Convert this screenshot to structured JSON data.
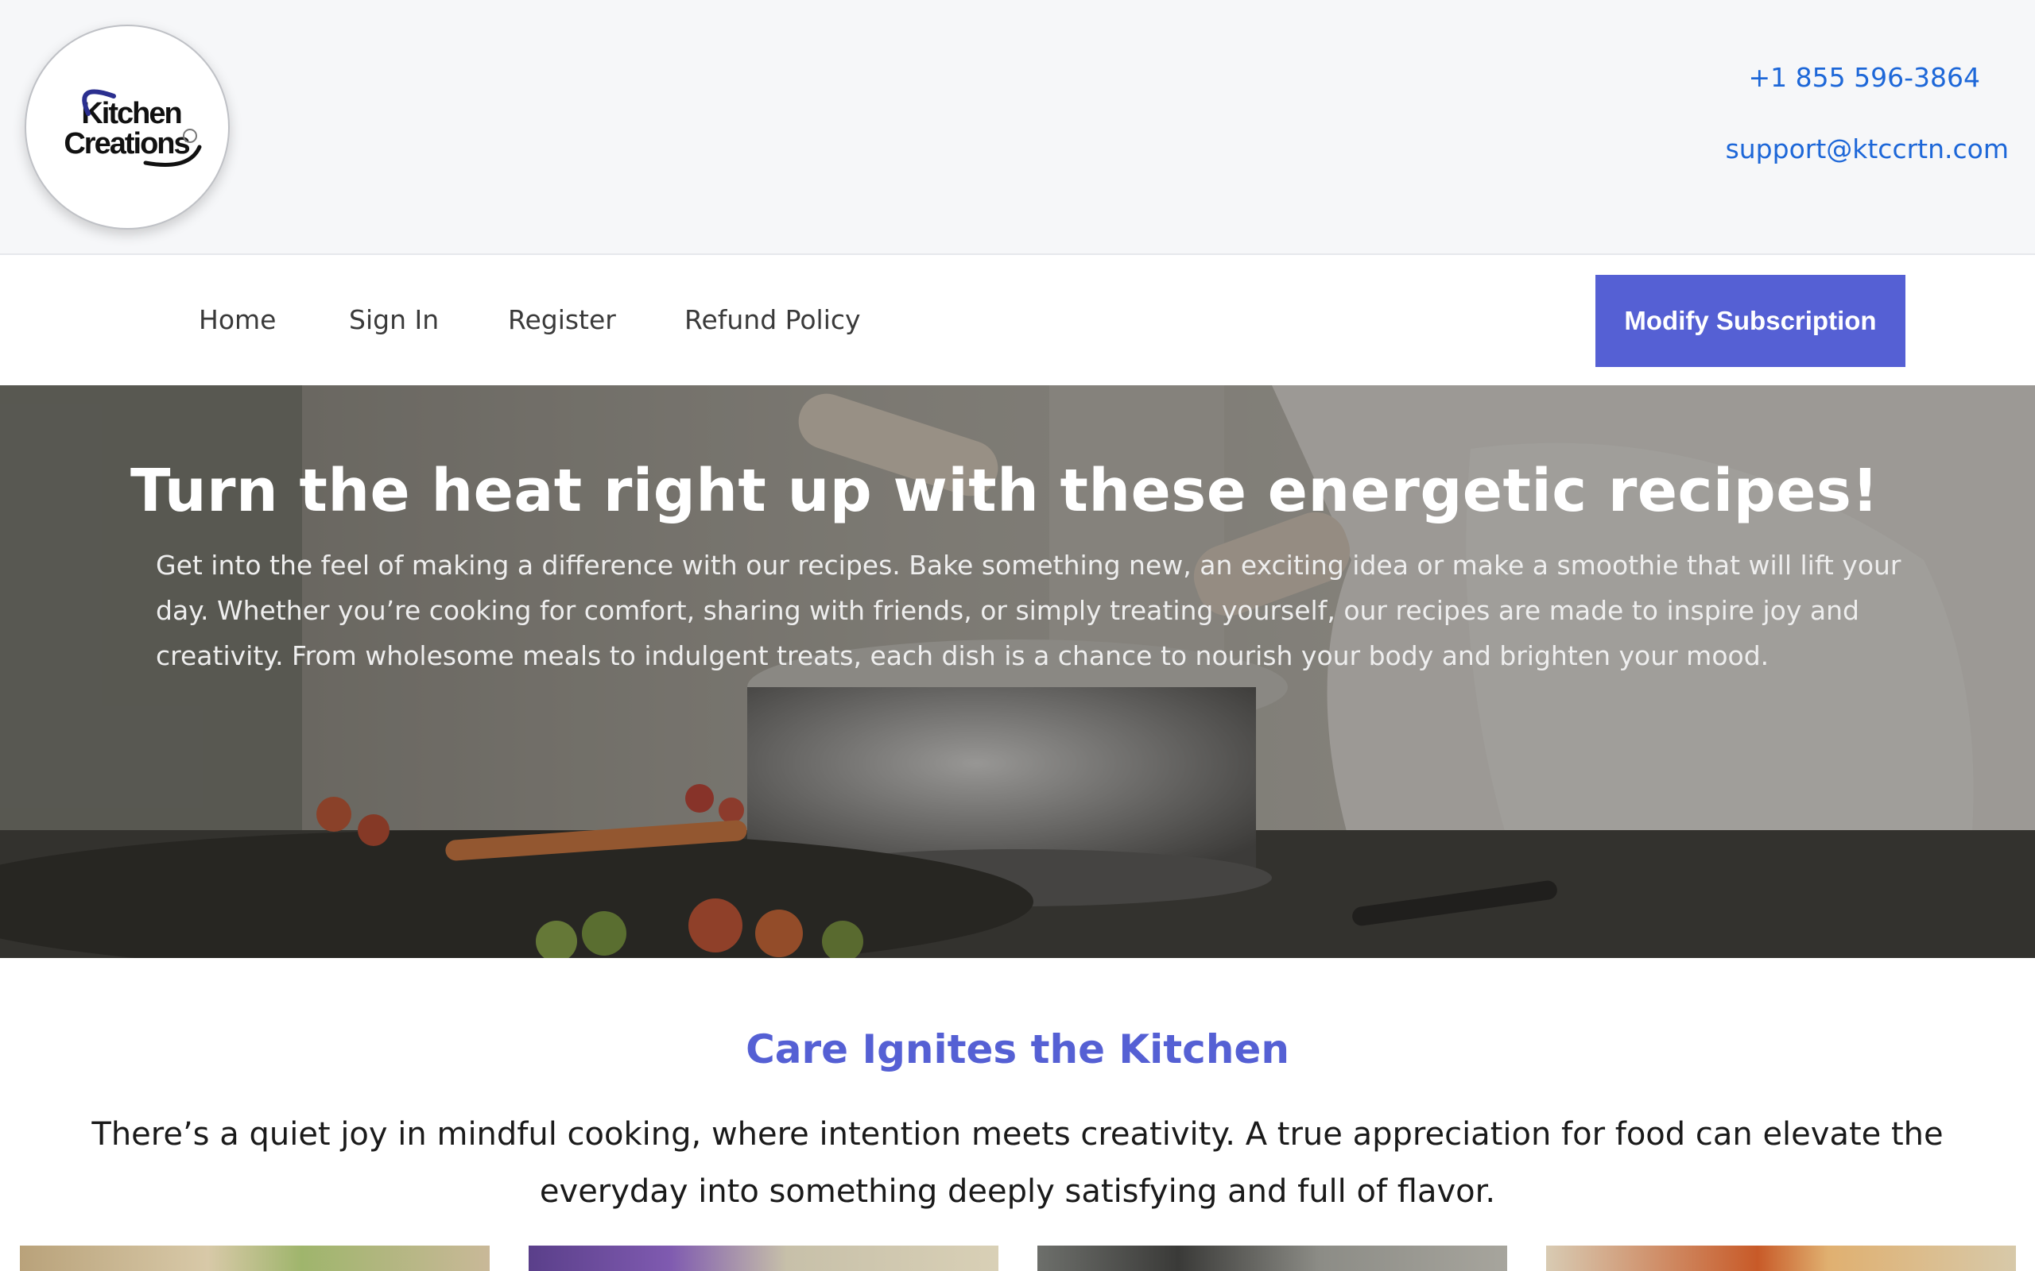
{
  "header": {
    "logo": {
      "line1": "Kitchen",
      "line2": "Creations"
    },
    "phone": "+1 855 596-3864",
    "email": "support@ktccrtn.com"
  },
  "nav": {
    "items": [
      {
        "label": "Home"
      },
      {
        "label": "Sign In"
      },
      {
        "label": "Register"
      },
      {
        "label": "Refund Policy"
      }
    ],
    "cta_label": "Modify Subscription"
  },
  "hero": {
    "title": "Turn the heat right up with these energetic recipes!",
    "text": "Get into the feel of making a difference with our recipes. Bake something new, an exciting idea or make a smoothie that will lift your day. Whether you’re cooking for comfort, sharing with friends, or simply treating yourself, our recipes are made to inspire joy and creativity. From wholesome meals to indulgent treats, each dish is a chance to nourish your body and brighten your mood."
  },
  "section": {
    "title": "Care Ignites the Kitchen",
    "text": "There’s a quiet joy in mindful cooking, where intention meets creativity. A true appreciation for food can elevate the everyday into something deeply satisfying and full of flavor."
  },
  "colors": {
    "accent": "#5560d4",
    "link": "#1d67d8",
    "topbar_bg": "#f6f7f9"
  }
}
